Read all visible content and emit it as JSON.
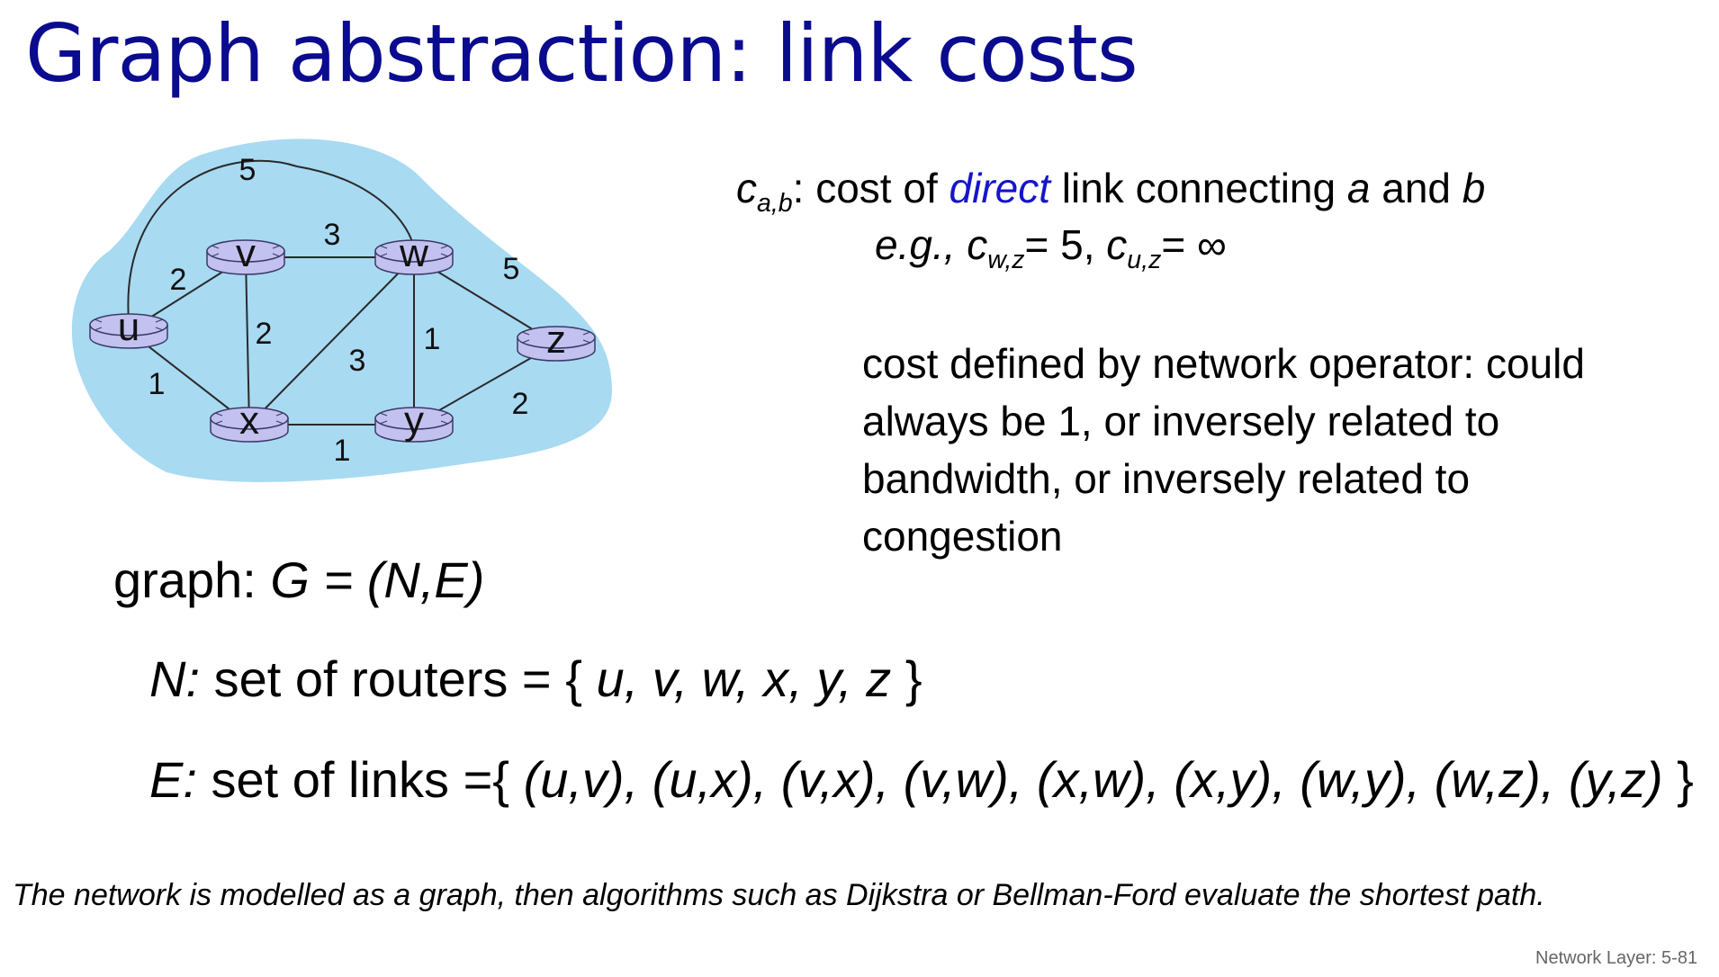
{
  "title": "Graph abstraction: link costs",
  "graph": {
    "nodes": [
      {
        "id": "u",
        "label": "u"
      },
      {
        "id": "v",
        "label": "v"
      },
      {
        "id": "w",
        "label": "w"
      },
      {
        "id": "x",
        "label": "x"
      },
      {
        "id": "y",
        "label": "y"
      },
      {
        "id": "z",
        "label": "z"
      }
    ],
    "edges": [
      {
        "from": "u",
        "to": "w",
        "cost": "5"
      },
      {
        "from": "u",
        "to": "v",
        "cost": "2"
      },
      {
        "from": "u",
        "to": "x",
        "cost": "1"
      },
      {
        "from": "v",
        "to": "w",
        "cost": "3"
      },
      {
        "from": "v",
        "to": "x",
        "cost": "2"
      },
      {
        "from": "w",
        "to": "x",
        "cost": "3"
      },
      {
        "from": "w",
        "to": "y",
        "cost": "1"
      },
      {
        "from": "w",
        "to": "z",
        "cost": "5"
      },
      {
        "from": "x",
        "to": "y",
        "cost": "1"
      },
      {
        "from": "y",
        "to": "z",
        "cost": "2"
      }
    ],
    "colors": {
      "cloud": "#a8daf2",
      "router_fill": "#c3c1f0",
      "router_stroke": "#3a3a66",
      "link": "#2a2a2a"
    }
  },
  "cost_definition": {
    "symbol": "c",
    "subscript": "a,b",
    "sep": ": cost of ",
    "emph": "direct",
    "mid": " link connecting ",
    "a": "a",
    "and": " and ",
    "b": "b"
  },
  "example": {
    "eg": "e.g.,",
    "c1_sub": "w,z",
    "c1_val": "= 5,",
    "c2_sub": "u,z",
    "c2_val": "= ∞"
  },
  "operator_text": "cost defined by network operator: could always be 1, or inversely related to bandwidth, or inversely related to congestion",
  "graph_def": {
    "label": "graph:",
    "expr": "G = (N,E)"
  },
  "nodes_def": {
    "label": "N:",
    "text": "set of routers = {",
    "items": "u, v, w, x, y, z",
    "close": "}"
  },
  "edges_def": {
    "label": "E:",
    "text": "set of links ={",
    "items": "(u,v), (u,x), (v,x), (v,w), (x,w), (x,y), (w,y), (w,z), (y,z)",
    "close": "}"
  },
  "note": "The network is modelled as a graph, then algorithms such as Dijkstra or Bellman-Ford evaluate the shortest path.",
  "footer": "Network Layer: 5-81"
}
